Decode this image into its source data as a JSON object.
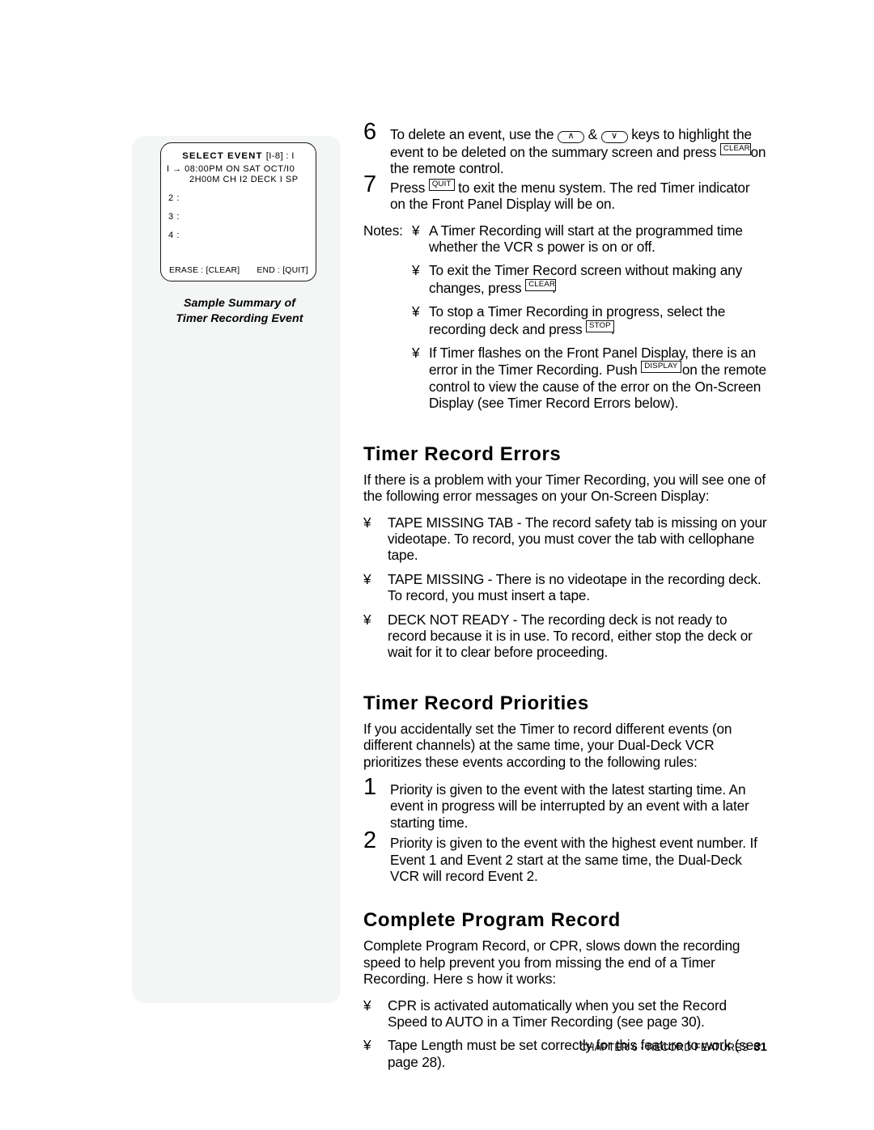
{
  "sidebar": {
    "osd_screen": {
      "title_label": "SELECT EVENT",
      "title_range": "[I-8] : I",
      "event1_line1": "I →  08:00PM  ON  SAT  OCT/I0",
      "event1_line2": "2H00M  CH I2  DECK I  SP",
      "rows": [
        "2 :",
        "3 :",
        "4 :"
      ],
      "footer_left": "ERASE : [CLEAR]",
      "footer_right": "END : [QUIT]"
    },
    "caption_line1": "Sample Summary of",
    "caption_line2": "Timer Recording Event"
  },
  "steps": [
    {
      "number": "6",
      "parts": [
        "To delete an event, use the ",
        " & ",
        " keys to highlight the event to be deleted on the summary screen and press ",
        " on the remote control."
      ],
      "key_up": "∧",
      "key_down": "∨",
      "key_clear": "CLEAR"
    },
    {
      "number": "7",
      "parts": [
        "Press ",
        " to exit the menu system. The red Timer indicator on the Front Panel Display will be on."
      ],
      "key_quit": "QUIT"
    }
  ],
  "notes": {
    "label": "Notes:",
    "bullet": "¥",
    "items": [
      {
        "text": "A Timer Recording will start at the programmed time whether the VCR s power is on or off."
      },
      {
        "pre": "To exit the Timer Record screen without making any changes, press ",
        "key": "CLEAR",
        "post": "."
      },
      {
        "pre": "To stop a Timer Recording in progress, select the recording deck and press  ",
        "key": "STOP",
        "post": "."
      },
      {
        "pre": "If Timer flashes on the Front Panel Display, there is an error in the Timer Recording. Push     ",
        "key": "DISPLAY",
        "post": " on the remote control to view the cause of the error on the On-Screen Display (see Timer Record Errors below)."
      }
    ]
  },
  "errors_section": {
    "heading": "Timer Record Errors",
    "intro": "If there is a problem with your Timer Recording, you will see one of the following error messages on your On-Screen Display:",
    "bullet": "¥",
    "items": [
      "TAPE MISSING TAB - The record safety tab is missing on your videotape. To record, you must cover the tab with cellophane tape.",
      "TAPE MISSING - There is no videotape in the recording deck. To record, you must insert a tape.",
      "DECK NOT READY  - The recording deck is not ready to record because it is in use. To record, either stop the deck or wait for it to clear before proceeding."
    ]
  },
  "priorities_section": {
    "heading": "Timer Record Priorities",
    "intro": "If you accidentally set the Timer to record different events (on different channels) at the same time, your Dual-Deck VCR prioritizes these events according to the following rules:",
    "items": [
      {
        "number": "1",
        "text": "Priority is given to the event with the latest starting time. An event in progress will be interrupted by an event with a later starting time."
      },
      {
        "number": "2",
        "text": "Priority is given to the event with the highest event number. If Event 1 and Event 2 start at the same time, the Dual-Deck VCR will record Event 2."
      }
    ]
  },
  "cpr_section": {
    "heading": "Complete Program Record",
    "intro": "Complete Program Record, or CPR, slows down the recording speed to help prevent you from missing the end of a Timer Recording. Here s how it works:",
    "bullet": "¥",
    "items": [
      "CPR is activated automatically when you set the Record Speed to AUTO in a Timer Recording (see page 30).",
      "Tape Length must be set correctly for this feature to work (see page 28)."
    ]
  },
  "footer": {
    "chapter_text": "CHAPTER 6 - RECORD FEATURES",
    "page_number": "31"
  }
}
